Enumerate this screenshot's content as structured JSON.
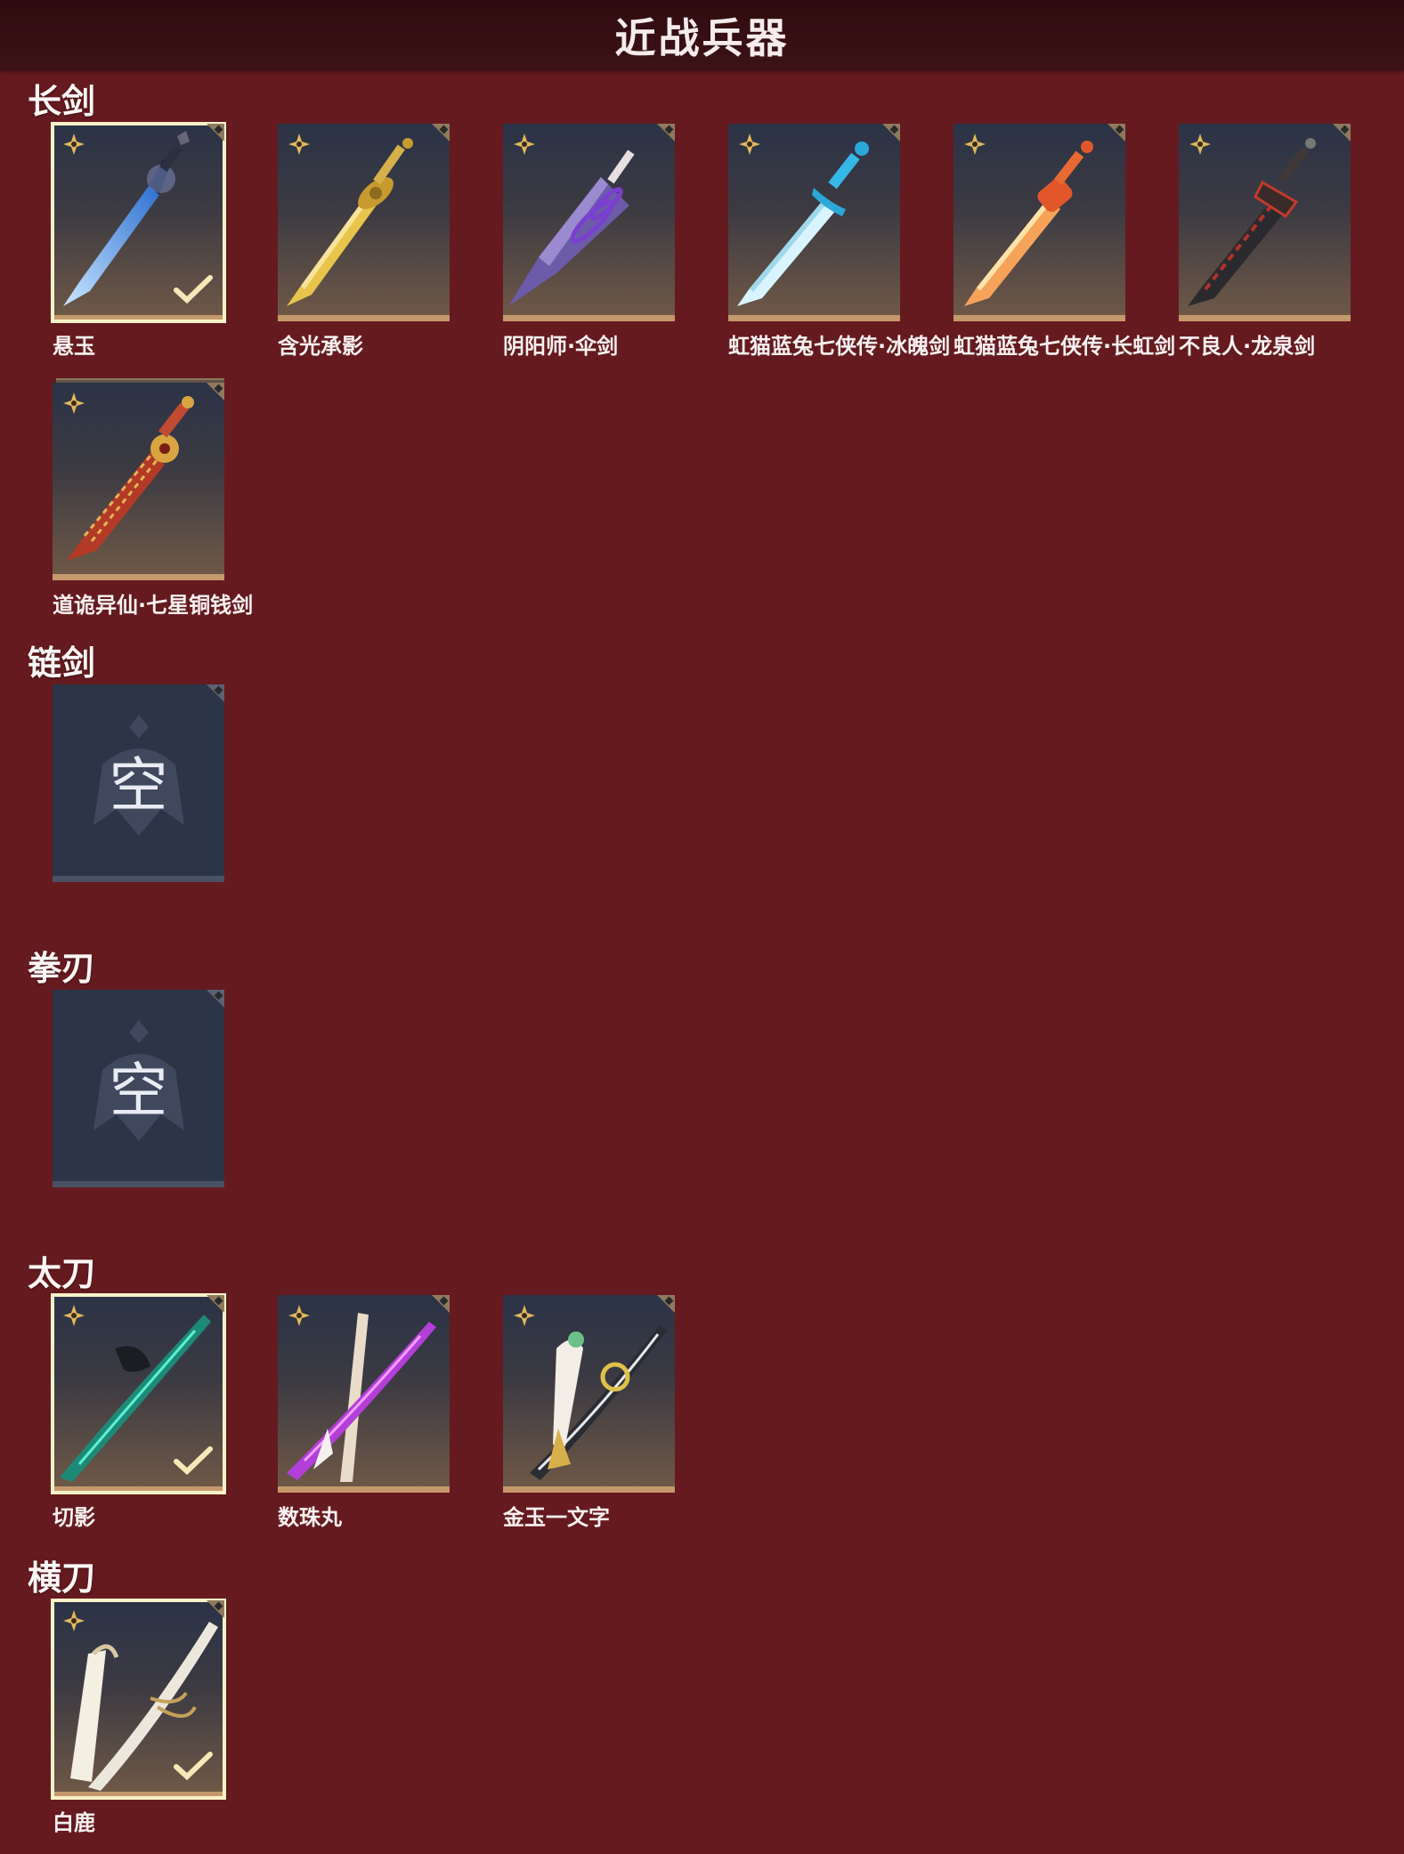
{
  "page": {
    "title": "近战兵器"
  },
  "sections": [
    {
      "title": "长剑",
      "items": [
        {
          "name": "悬玉",
          "selected": true
        },
        {
          "name": "含光承影",
          "selected": false
        },
        {
          "name": "阴阳师·伞剑",
          "selected": false
        },
        {
          "name": "虹猫蓝兔七侠传·冰魄剑",
          "selected": false
        },
        {
          "name": "虹猫蓝兔七侠传·长虹剑",
          "selected": false
        },
        {
          "name": "不良人·龙泉剑",
          "selected": false
        },
        {
          "name": "道诡异仙·七星铜钱剑",
          "selected": false
        }
      ]
    },
    {
      "title": "链剑",
      "empty_label": "空"
    },
    {
      "title": "拳刃",
      "empty_label": "空"
    },
    {
      "title": "太刀",
      "items": [
        {
          "name": "切影",
          "selected": true
        },
        {
          "name": "数珠丸",
          "selected": false
        },
        {
          "name": "金玉一文字",
          "selected": false
        }
      ]
    },
    {
      "title": "横刀",
      "items": [
        {
          "name": "白鹿",
          "selected": true
        }
      ]
    }
  ],
  "colors": {
    "background": "#651a1f",
    "header": "#2f0c0f",
    "tile_border": "#c5996b",
    "selected_outline": "#fbf1c8",
    "empty_tile": "#2c3447"
  },
  "icons": {
    "rarity": "four-point-star-icon",
    "equipped": "checkmark-icon",
    "corner": "diamond-corner-icon",
    "empty_slot": "helmet-emblem-icon"
  }
}
